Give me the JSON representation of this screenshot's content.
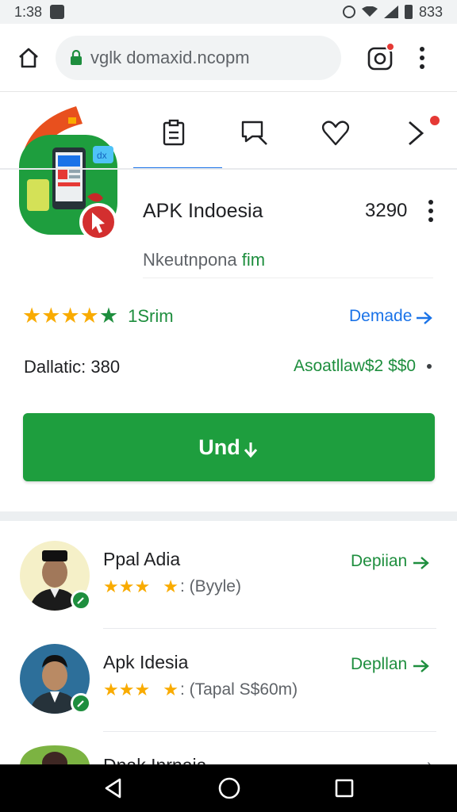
{
  "status_bar": {
    "time": "1:38",
    "battery_text": "833"
  },
  "browser": {
    "url": "vglk domaxid.ncopm"
  },
  "tabs": [
    "clipboard",
    "search",
    "heart",
    "arrow"
  ],
  "app": {
    "title": "APK Indoesia",
    "size": "3290",
    "developer_prefix": "Nkeutnpona",
    "developer_suffix": "fim",
    "rating_count": "1Srim",
    "demade_label": "Demade",
    "detail_label": "Dallatic:  380",
    "detail_value": "Asoatllaw$2 $$0",
    "install_label": "Und"
  },
  "list": [
    {
      "name": "Ppal Adia",
      "meta": ": (Byyle)",
      "action": "Depiian"
    },
    {
      "name": "Apk Idesia",
      "meta": ": (Tapal  S$60m)",
      "action": "Depllan"
    },
    {
      "name": "Dnak Inrnaia"
    }
  ],
  "colors": {
    "accent_green": "#1e9e3e",
    "link_blue": "#1a73e8",
    "star_gold": "#f9ab00"
  }
}
